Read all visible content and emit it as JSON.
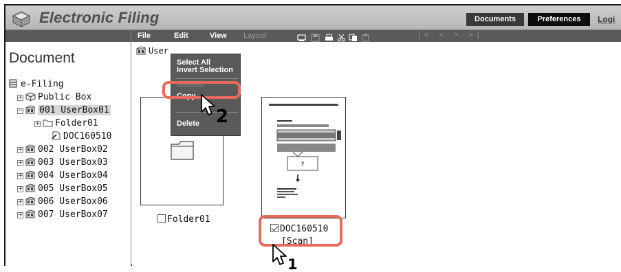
{
  "header": {
    "title": "Electronic Filing",
    "documents_label": "Documents",
    "preferences_label": "Preferences",
    "login_label": "Logi"
  },
  "menubar": {
    "file": "File",
    "edit": "Edit",
    "view": "View",
    "layout": "Layout",
    "nav": "|< < > >|"
  },
  "edit_menu": {
    "select_all": "Select All",
    "invert_selection": "Invert Selection",
    "copy": "Copy",
    "delete": "Delete"
  },
  "tree": {
    "title": "Document",
    "root": "e-Filing",
    "items": [
      {
        "label": "Public Box"
      },
      {
        "label": "001 UserBox01"
      },
      {
        "label": "Folder01"
      },
      {
        "label": "DOC160510"
      },
      {
        "label": "002 UserBox02"
      },
      {
        "label": "003 UserBox03"
      },
      {
        "label": "004 UserBox04"
      },
      {
        "label": "005 UserBox05"
      },
      {
        "label": "006 UserBox06"
      },
      {
        "label": "007 UserBox07"
      }
    ]
  },
  "content": {
    "path": "User",
    "folder_caption": "Folder01",
    "doc_caption": "DOC160510",
    "doc_type": "[Scan]",
    "doc_question": "?"
  },
  "steps": {
    "one": "1",
    "two": "2"
  },
  "colors": {
    "callout": "#e86a5a",
    "menubar": "#5a5a5a"
  }
}
